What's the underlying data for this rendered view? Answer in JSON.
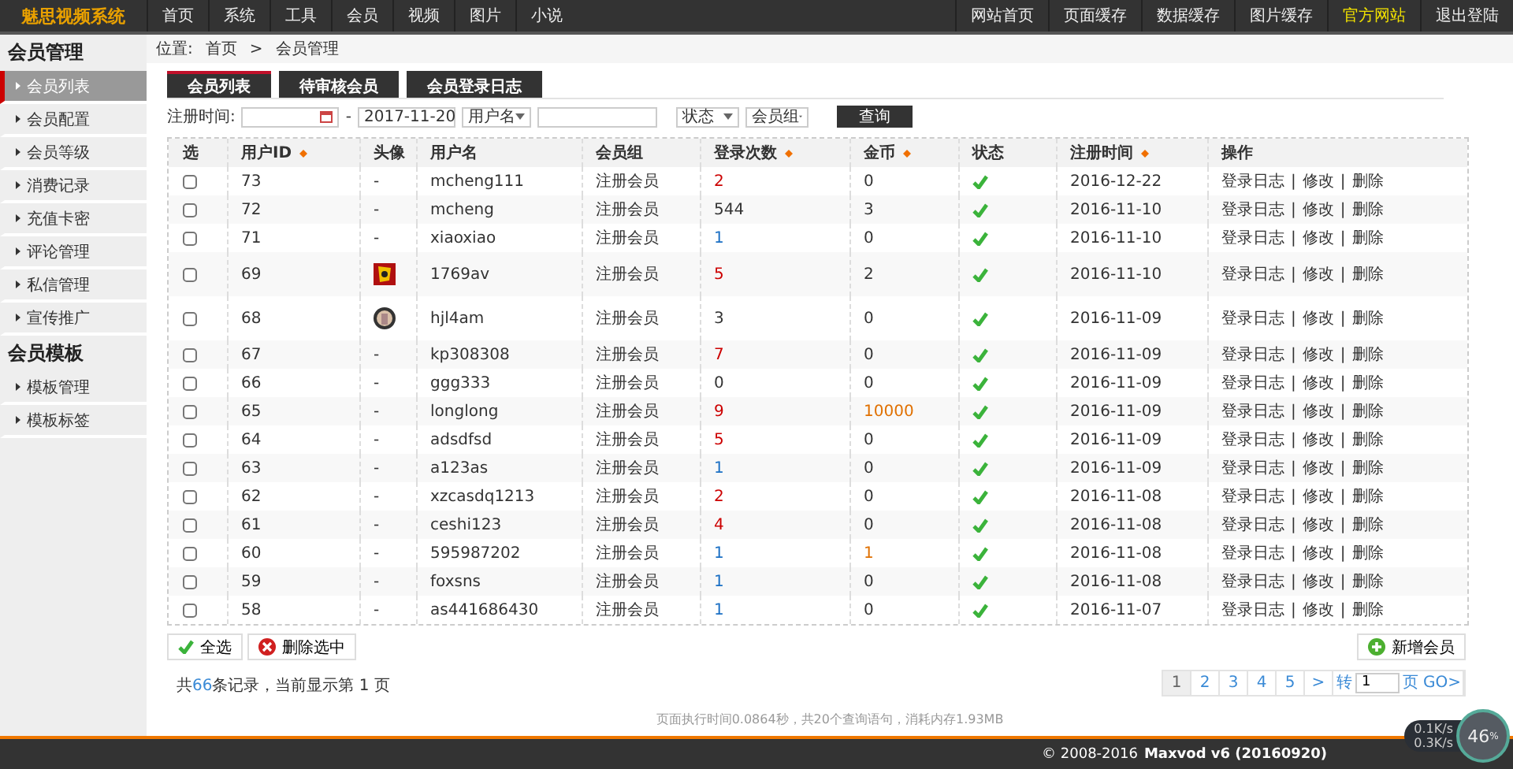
{
  "logo": "魅思视频系统",
  "nav": [
    {
      "label": "首页"
    },
    {
      "label": "系统"
    },
    {
      "label": "工具"
    },
    {
      "label": "会员"
    },
    {
      "label": "视频"
    },
    {
      "label": "图片"
    },
    {
      "label": "小说"
    }
  ],
  "nav_right": [
    {
      "label": "网站首页",
      "highlighted": false
    },
    {
      "label": "页面缓存",
      "highlighted": false
    },
    {
      "label": "数据缓存",
      "highlighted": false
    },
    {
      "label": "图片缓存",
      "highlighted": false
    },
    {
      "label": "官方网站",
      "highlighted": true
    },
    {
      "label": "退出登陆",
      "highlighted": false
    }
  ],
  "sidebar": [
    {
      "title": "会员管理",
      "items": [
        {
          "label": "会员列表",
          "selected": true
        },
        {
          "label": "会员配置",
          "selected": false
        },
        {
          "label": "会员等级",
          "selected": false
        },
        {
          "label": "消费记录",
          "selected": false
        },
        {
          "label": "充值卡密",
          "selected": false
        },
        {
          "label": "评论管理",
          "selected": false
        },
        {
          "label": "私信管理",
          "selected": false
        },
        {
          "label": "宣传推广",
          "selected": false
        }
      ]
    },
    {
      "title": "会员模板",
      "items": [
        {
          "label": "模板管理",
          "selected": false
        },
        {
          "label": "模板标签",
          "selected": false
        }
      ]
    }
  ],
  "breadcrumb": {
    "label": "位置:",
    "items": [
      "首页",
      "会员管理"
    ],
    "separator": ">"
  },
  "tabs": [
    {
      "label": "会员列表",
      "selected": true
    },
    {
      "label": "待审核会员",
      "selected": false
    },
    {
      "label": "会员登录日志",
      "selected": false
    }
  ],
  "filter": {
    "label": "注册时间:",
    "dash": "-",
    "date_to": "2017-11-20",
    "field_select": "用户名",
    "status_select": "状态",
    "group_select": "会员组",
    "search_button": "查询"
  },
  "table": {
    "action_separator": "|",
    "columns": [
      {
        "label": "选",
        "sortable": false
      },
      {
        "label": "用户ID",
        "sortable": true
      },
      {
        "label": "头像",
        "sortable": false
      },
      {
        "label": "用户名",
        "sortable": false
      },
      {
        "label": "会员组",
        "sortable": false
      },
      {
        "label": "登录次数",
        "sortable": true
      },
      {
        "label": "金币",
        "sortable": true
      },
      {
        "label": "状态",
        "sortable": false
      },
      {
        "label": "注册时间",
        "sortable": true
      },
      {
        "label": "操作",
        "sortable": false
      }
    ],
    "rows": [
      {
        "checked": false,
        "id": "73",
        "avatar": {
          "kind": "none",
          "text": "-"
        },
        "username": "mcheng111",
        "group": "注册会员",
        "logins": {
          "text": "2",
          "color": "#cc0000"
        },
        "coins": {
          "text": "0",
          "color": "#333333"
        },
        "active": true,
        "date": "2016-12-22",
        "actions": [
          "登录日志",
          "修改",
          "删除"
        ]
      },
      {
        "checked": false,
        "id": "72",
        "avatar": {
          "kind": "none",
          "text": "-"
        },
        "username": "mcheng",
        "group": "注册会员",
        "logins": {
          "text": "544",
          "color": "#333333"
        },
        "coins": {
          "text": "3",
          "color": "#333333"
        },
        "active": true,
        "date": "2016-11-10",
        "actions": [
          "登录日志",
          "修改",
          "删除"
        ]
      },
      {
        "checked": false,
        "id": "71",
        "avatar": {
          "kind": "none",
          "text": "-"
        },
        "username": "xiaoxiao",
        "group": "注册会员",
        "logins": {
          "text": "1",
          "color": "#1a6fc4"
        },
        "coins": {
          "text": "0",
          "color": "#333333"
        },
        "active": true,
        "date": "2016-11-10",
        "actions": [
          "登录日志",
          "修改",
          "删除"
        ]
      },
      {
        "checked": false,
        "id": "69",
        "username": "1769av",
        "group": "注册会员",
        "logins": {
          "text": "5",
          "color": "#cc0000"
        },
        "coins": {
          "text": "2",
          "color": "#333333"
        },
        "active": true,
        "date": "2016-11-10",
        "actions": [
          "登录日志",
          "修改",
          "删除"
        ]
      },
      {
        "checked": false,
        "id": "68",
        "username": "hjl4am",
        "group": "注册会员",
        "logins": {
          "text": "3",
          "color": "#333333"
        },
        "coins": {
          "text": "0",
          "color": "#333333"
        },
        "active": true,
        "date": "2016-11-09",
        "actions": [
          "登录日志",
          "修改",
          "删除"
        ]
      },
      {
        "checked": false,
        "id": "67",
        "avatar": {
          "kind": "none",
          "text": "-"
        },
        "username": "kp308308",
        "group": "注册会员",
        "logins": {
          "text": "7",
          "color": "#cc0000"
        },
        "coins": {
          "text": "0",
          "color": "#333333"
        },
        "active": true,
        "date": "2016-11-09",
        "actions": [
          "登录日志",
          "修改",
          "删除"
        ]
      },
      {
        "checked": false,
        "id": "66",
        "avatar": {
          "kind": "none",
          "text": "-"
        },
        "username": "ggg333",
        "group": "注册会员",
        "logins": {
          "text": "0",
          "color": "#333333"
        },
        "coins": {
          "text": "0",
          "color": "#333333"
        },
        "active": true,
        "date": "2016-11-09",
        "actions": [
          "登录日志",
          "修改",
          "删除"
        ]
      },
      {
        "checked": false,
        "id": "65",
        "avatar": {
          "kind": "none",
          "text": "-"
        },
        "username": "longlong",
        "group": "注册会员",
        "logins": {
          "text": "9",
          "color": "#cc0000"
        },
        "coins": {
          "text": "10000",
          "color": "#e07000"
        },
        "active": true,
        "date": "2016-11-09",
        "actions": [
          "登录日志",
          "修改",
          "删除"
        ]
      },
      {
        "checked": false,
        "id": "64",
        "avatar": {
          "kind": "none",
          "text": "-"
        },
        "username": "adsdfsd",
        "group": "注册会员",
        "logins": {
          "text": "5",
          "color": "#cc0000"
        },
        "coins": {
          "text": "0",
          "color": "#333333"
        },
        "active": true,
        "date": "2016-11-09",
        "actions": [
          "登录日志",
          "修改",
          "删除"
        ]
      },
      {
        "checked": false,
        "id": "63",
        "avatar": {
          "kind": "none",
          "text": "-"
        },
        "username": "a123as",
        "group": "注册会员",
        "logins": {
          "text": "1",
          "color": "#1a6fc4"
        },
        "coins": {
          "text": "0",
          "color": "#333333"
        },
        "active": true,
        "date": "2016-11-09",
        "actions": [
          "登录日志",
          "修改",
          "删除"
        ]
      },
      {
        "checked": false,
        "id": "62",
        "avatar": {
          "kind": "none",
          "text": "-"
        },
        "username": "xzcasdq1213",
        "group": "注册会员",
        "logins": {
          "text": "2",
          "color": "#cc0000"
        },
        "coins": {
          "text": "0",
          "color": "#333333"
        },
        "active": true,
        "date": "2016-11-08",
        "actions": [
          "登录日志",
          "修改",
          "删除"
        ]
      },
      {
        "checked": false,
        "id": "61",
        "avatar": {
          "kind": "none",
          "text": "-"
        },
        "username": "ceshi123",
        "group": "注册会员",
        "logins": {
          "text": "4",
          "color": "#cc0000"
        },
        "coins": {
          "text": "0",
          "color": "#333333"
        },
        "active": true,
        "date": "2016-11-08",
        "actions": [
          "登录日志",
          "修改",
          "删除"
        ]
      },
      {
        "checked": false,
        "id": "60",
        "avatar": {
          "kind": "none",
          "text": "-"
        },
        "username": "595987202",
        "group": "注册会员",
        "logins": {
          "text": "1",
          "color": "#1a6fc4"
        },
        "coins": {
          "text": "1",
          "color": "#e07000"
        },
        "active": true,
        "date": "2016-11-08",
        "actions": [
          "登录日志",
          "修改",
          "删除"
        ]
      },
      {
        "checked": false,
        "id": "59",
        "avatar": {
          "kind": "none",
          "text": "-"
        },
        "username": "foxsns",
        "group": "注册会员",
        "logins": {
          "text": "1",
          "color": "#1a6fc4"
        },
        "coins": {
          "text": "0",
          "color": "#333333"
        },
        "active": true,
        "date": "2016-11-08",
        "actions": [
          "登录日志",
          "修改",
          "删除"
        ]
      },
      {
        "checked": false,
        "id": "58",
        "avatar": {
          "kind": "none",
          "text": "-"
        },
        "username": "as441686430",
        "group": "注册会员",
        "logins": {
          "text": "1",
          "color": "#1a6fc4"
        },
        "coins": {
          "text": "0",
          "color": "#333333"
        },
        "active": true,
        "date": "2016-11-07",
        "actions": [
          "登录日志",
          "修改",
          "删除"
        ]
      }
    ]
  },
  "select_all_button": "全选",
  "delete_selected_button": "删除选中",
  "add_button": "新增会员",
  "summary": {
    "prefix": "共",
    "count": "66",
    "suffix": "条记录，当前显示第 1 页"
  },
  "pagination": {
    "pages": [
      {
        "label": "1",
        "selected": true
      },
      {
        "label": "2",
        "selected": false
      },
      {
        "label": "3",
        "selected": false
      },
      {
        "label": "4",
        "selected": false
      },
      {
        "label": "5",
        "selected": false
      }
    ],
    "next": ">",
    "goto_label": "转",
    "goto_value": "1",
    "page_label": "页",
    "go": "GO>"
  },
  "exec_info": "页面执行时间0.0864秒，共20个查询语句，消耗内存1.93MB",
  "footer": {
    "copyright": "© 2008-2016",
    "product": "Maxvod v6 (20160920)"
  },
  "speed_widget": {
    "upload": "0.1K/s",
    "download": "0.3K/s",
    "percent": "46",
    "unit": "%"
  }
}
